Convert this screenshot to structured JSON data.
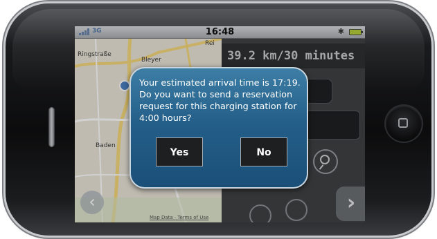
{
  "statusbar": {
    "carrier": "3G",
    "time": "16:48",
    "bluetooth_icon": "bluetooth-icon",
    "battery_icon": "battery-icon"
  },
  "map": {
    "labels": {
      "top_left": "Ringstraße",
      "top_mid": "Bleyer",
      "middle": "Baden",
      "top_right": "Rei"
    },
    "credit": "Map Data · Terms of Use",
    "back_icon": "chevron-left-icon"
  },
  "panel": {
    "distance": "39.2 km/30 minutes",
    "search_icon": "search-icon",
    "next_icon": "chevron-right-icon"
  },
  "dialog": {
    "message": "Your estimated arrival time is 17:19. Do you want to send a reservation request for this charging station for 4:00 hours?",
    "yes_label": "Yes",
    "no_label": "No"
  },
  "colors": {
    "dialog_top": "#3d7ea6",
    "dialog_bottom": "#1a4f78",
    "button_bg": "#1e1f21",
    "panel_bg": "#3f4144"
  }
}
